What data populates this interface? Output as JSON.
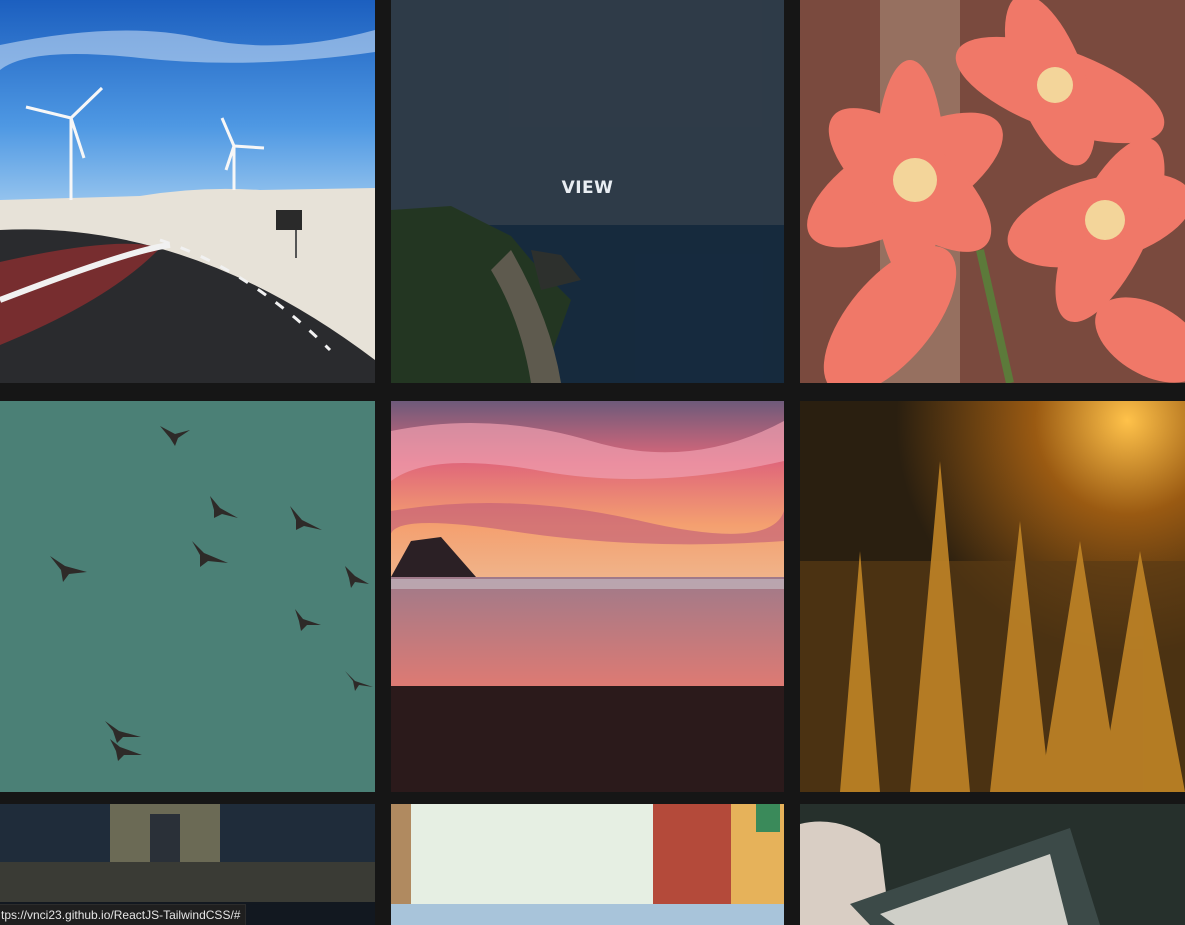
{
  "gallery": {
    "tiles": [
      {
        "name": "wind-turbines-road"
      },
      {
        "name": "coastal-cliffs",
        "overlay_label": "VIEW"
      },
      {
        "name": "red-flowers"
      },
      {
        "name": "birds-in-sky"
      },
      {
        "name": "beach-sunset"
      },
      {
        "name": "golden-grass"
      },
      {
        "name": "dark-buildings"
      },
      {
        "name": "colorful-street"
      },
      {
        "name": "kindle-reader"
      }
    ]
  },
  "status_bar": {
    "url": "tps://vnci23.github.io/ReactJS-TailwindCSS/#"
  }
}
